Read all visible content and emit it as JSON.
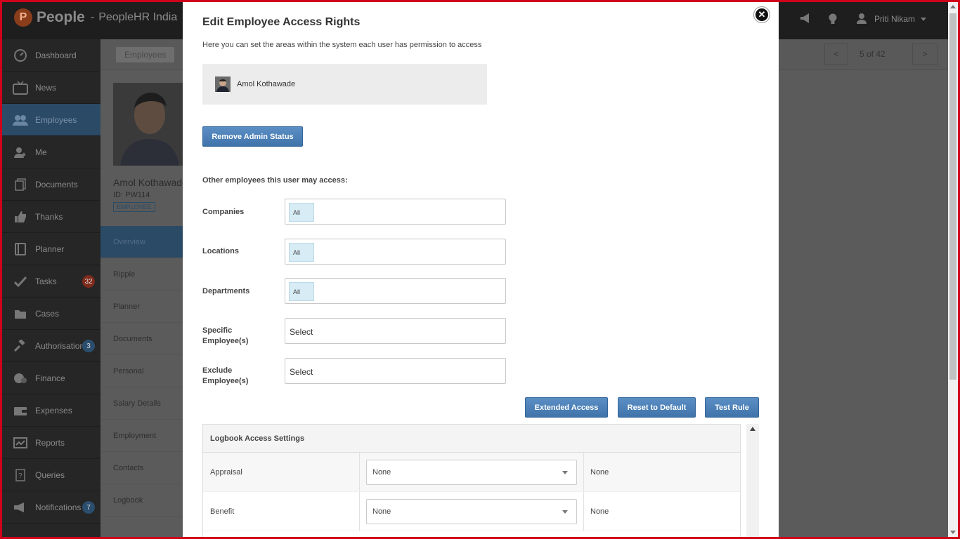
{
  "header": {
    "logo_word": "People",
    "separator": "-",
    "company": "PeopleHR India",
    "user_name": "Priti Nikam"
  },
  "sidebar": {
    "items": [
      {
        "label": "Dashboard",
        "icon": "dashboard-icon"
      },
      {
        "label": "News",
        "icon": "tv-icon"
      },
      {
        "label": "Employees",
        "icon": "users-icon"
      },
      {
        "label": "Me",
        "icon": "user-star-icon"
      },
      {
        "label": "Documents",
        "icon": "documents-icon"
      },
      {
        "label": "Thanks",
        "icon": "thumbs-up-icon"
      },
      {
        "label": "Planner",
        "icon": "planner-icon"
      },
      {
        "label": "Tasks",
        "icon": "check-icon",
        "badge": "32"
      },
      {
        "label": "Cases",
        "icon": "folder-icon"
      },
      {
        "label": "Authorisations",
        "icon": "gavel-icon",
        "badge": "3"
      },
      {
        "label": "Finance",
        "icon": "coins-icon"
      },
      {
        "label": "Expenses",
        "icon": "wallet-icon"
      },
      {
        "label": "Reports",
        "icon": "chart-icon"
      },
      {
        "label": "Queries",
        "icon": "question-icon"
      },
      {
        "label": "Notifications",
        "icon": "megaphone-icon",
        "badge": "7"
      }
    ],
    "active": "Employees"
  },
  "page": {
    "breadcrumb": "Employees",
    "pager_prev": "<",
    "pager_text": "5 of 42",
    "pager_next": ">",
    "employee_name": "Amol Kothawade",
    "employee_id": "ID: PW114",
    "employee_tag": "EMPLOYEE",
    "subnav": [
      "Overview",
      "Ripple",
      "Planner",
      "Documents",
      "Personal",
      "Salary Details",
      "Employment",
      "Contacts",
      "Logbook"
    ],
    "subnav_active": "Overview"
  },
  "modal": {
    "title": "Edit Employee Access Rights",
    "subtitle": "Here you can set the areas within the system each user has permission to access",
    "employee_name": "Amol Kothawade",
    "remove_admin_label": "Remove Admin Status",
    "section_label": "Other employees this user may access:",
    "fields": {
      "companies": {
        "label": "Companies",
        "value": "All"
      },
      "locations": {
        "label": "Locations",
        "value": "All"
      },
      "departments": {
        "label": "Departments",
        "value": "All"
      },
      "specific": {
        "label": "Specific Employee(s)",
        "placeholder": "Select"
      },
      "exclude": {
        "label": "Exclude Employee(s)",
        "placeholder": "Select"
      }
    },
    "buttons": {
      "extended_access": "Extended Access",
      "reset_default": "Reset to Default",
      "test_rule": "Test Rule"
    },
    "logbook": {
      "title": "Logbook Access Settings",
      "rows": [
        {
          "name": "Appraisal",
          "select": "None",
          "value": "None"
        },
        {
          "name": "Benefit",
          "select": "None",
          "value": "None"
        }
      ]
    }
  }
}
